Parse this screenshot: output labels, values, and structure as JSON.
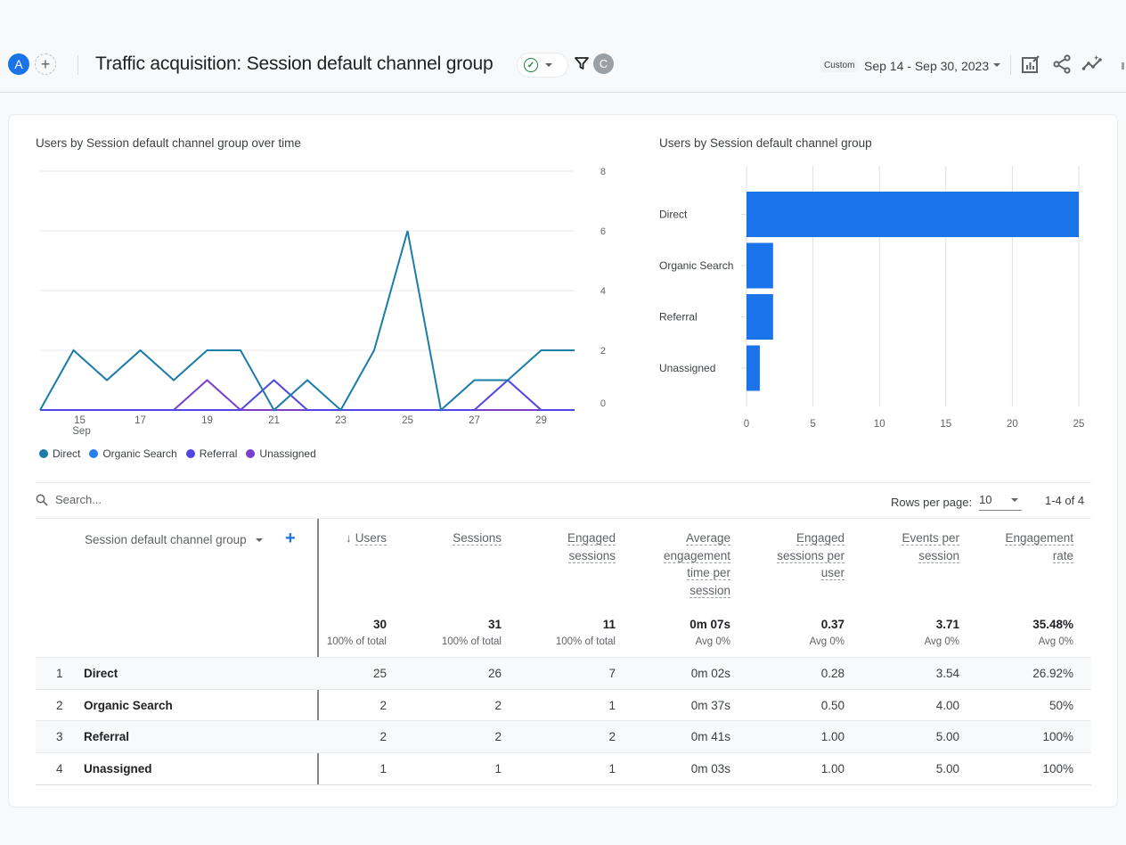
{
  "header": {
    "avatar_label": "A",
    "title": "Traffic acquisition: Session default channel group",
    "comparison_avatar": "C",
    "date_chip": "Custom",
    "date_range": "Sep 14 - Sep 30, 2023"
  },
  "colors": {
    "accent": "#1a73e8",
    "direct": "#1b7ca8",
    "organic_search": "#2b7de9",
    "referral": "#4f46e5",
    "unassigned": "#7b3fd0",
    "bar": "#1a73e8"
  },
  "line_chart": {
    "title": "Users by Session default channel group over time",
    "legend": [
      "Direct",
      "Organic Search",
      "Referral",
      "Unassigned"
    ]
  },
  "bar_chart": {
    "title": "Users by Session default channel group"
  },
  "chart_data": [
    {
      "type": "line",
      "title": "Users by Session default channel group over time",
      "x": [
        14,
        15,
        16,
        17,
        18,
        19,
        20,
        21,
        22,
        23,
        24,
        25,
        26,
        27,
        28,
        29,
        30
      ],
      "x_tick_labels": [
        "15",
        "17",
        "19",
        "21",
        "23",
        "25",
        "27",
        "29"
      ],
      "x_tick_values": [
        15,
        17,
        19,
        21,
        23,
        25,
        27,
        29
      ],
      "x_sublabel": "Sep",
      "ylim": [
        0,
        8
      ],
      "y_ticks": [
        0,
        2,
        4,
        6,
        8
      ],
      "y_axis_side": "right",
      "grid": true,
      "legend_position": "bottom-left",
      "series": [
        {
          "name": "Direct",
          "values": [
            0,
            2,
            1,
            2,
            1,
            2,
            2,
            0,
            1,
            0,
            2,
            6,
            0,
            1,
            1,
            2,
            2
          ]
        },
        {
          "name": "Organic Search",
          "values": [
            0,
            0,
            0,
            0,
            0,
            0,
            0,
            0,
            0,
            0,
            0,
            0,
            0,
            0,
            0,
            0,
            0
          ]
        },
        {
          "name": "Referral",
          "values": [
            0,
            0,
            0,
            0,
            0,
            0,
            0,
            1,
            0,
            0,
            0,
            0,
            0,
            0,
            1,
            0,
            0
          ]
        },
        {
          "name": "Unassigned",
          "values": [
            0,
            0,
            0,
            0,
            0,
            1,
            0,
            0,
            0,
            0,
            0,
            0,
            0,
            0,
            0,
            0,
            0
          ]
        }
      ]
    },
    {
      "type": "bar",
      "orientation": "horizontal",
      "title": "Users by Session default channel group",
      "categories": [
        "Direct",
        "Organic Search",
        "Referral",
        "Unassigned"
      ],
      "values": [
        25,
        2,
        2,
        1
      ],
      "xlim": [
        0,
        25
      ],
      "x_ticks": [
        0,
        5,
        10,
        15,
        20,
        25
      ],
      "grid": true
    }
  ],
  "table": {
    "search_placeholder": "Search...",
    "rows_per_page_label": "Rows per page:",
    "rows_per_page_value": "10",
    "pagination": "1-4 of 4",
    "dimension_header": "Session default channel group",
    "sort_arrow": "↓",
    "columns": [
      {
        "lines": [
          "Users"
        ],
        "total": "30",
        "sub": "100% of total"
      },
      {
        "lines": [
          "Sessions"
        ],
        "total": "31",
        "sub": "100% of total"
      },
      {
        "lines": [
          "Engaged",
          "sessions"
        ],
        "total": "11",
        "sub": "100% of total"
      },
      {
        "lines": [
          "Average",
          "engagement",
          "time per",
          "session"
        ],
        "total": "0m 07s",
        "sub": "Avg 0%"
      },
      {
        "lines": [
          "Engaged",
          "sessions per",
          "user"
        ],
        "total": "0.37",
        "sub": "Avg 0%"
      },
      {
        "lines": [
          "Events per",
          "session"
        ],
        "total": "3.71",
        "sub": "Avg 0%"
      },
      {
        "lines": [
          "Engagement",
          "rate"
        ],
        "total": "35.48%",
        "sub": "Avg 0%"
      }
    ],
    "rows": [
      {
        "index": "1",
        "name": "Direct",
        "values": [
          "25",
          "26",
          "7",
          "0m 02s",
          "0.28",
          "3.54",
          "26.92%"
        ]
      },
      {
        "index": "2",
        "name": "Organic Search",
        "values": [
          "2",
          "2",
          "1",
          "0m 37s",
          "0.50",
          "4.00",
          "50%"
        ]
      },
      {
        "index": "3",
        "name": "Referral",
        "values": [
          "2",
          "2",
          "2",
          "0m 41s",
          "1.00",
          "5.00",
          "100%"
        ]
      },
      {
        "index": "4",
        "name": "Unassigned",
        "values": [
          "1",
          "1",
          "1",
          "0m 03s",
          "1.00",
          "5.00",
          "100%"
        ]
      }
    ]
  }
}
